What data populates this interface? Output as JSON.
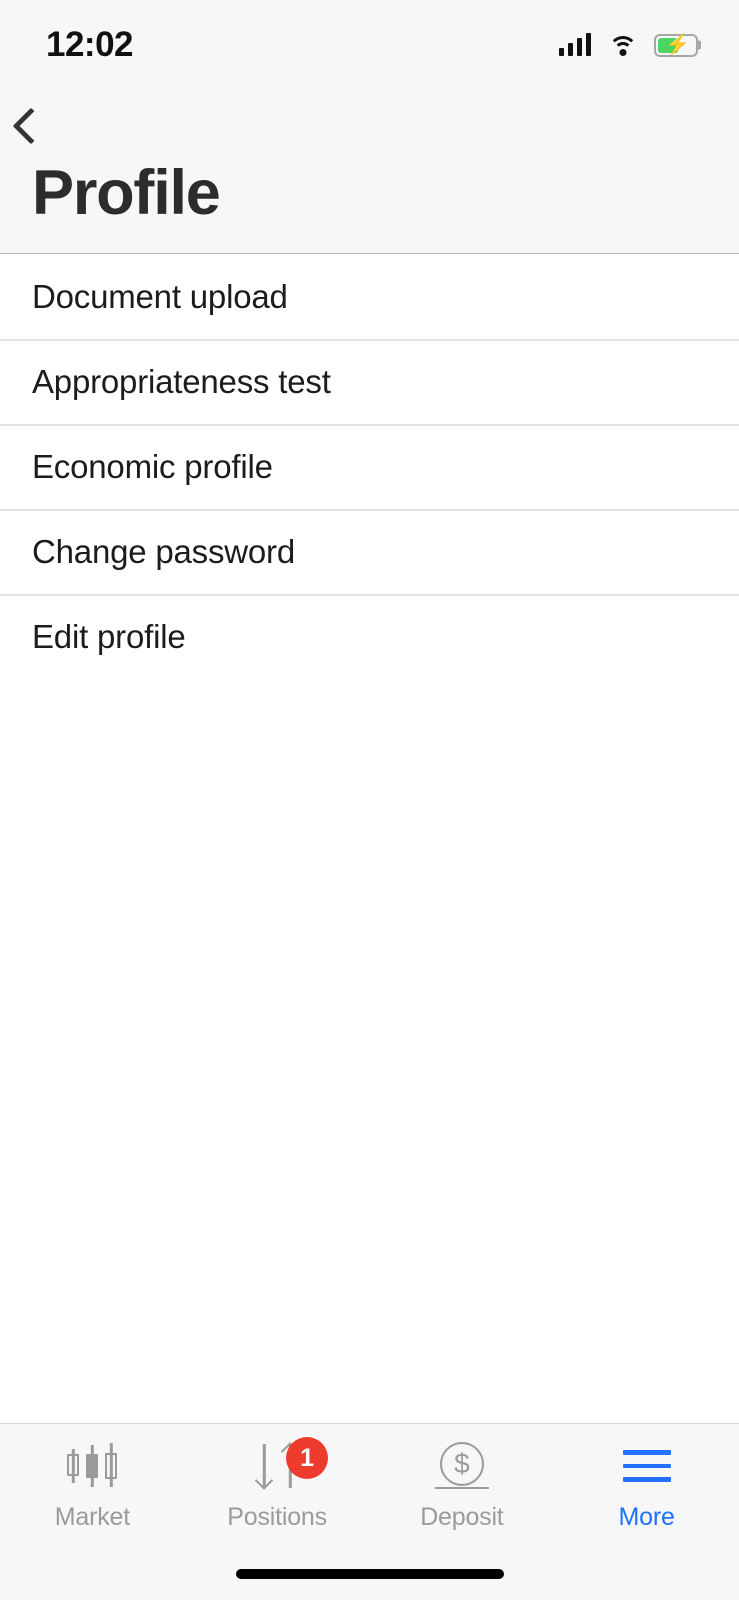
{
  "status_bar": {
    "time": "12:02",
    "signal_icon": "signal-bars-icon",
    "wifi_icon": "wifi-icon",
    "battery_icon": "battery-charging-icon",
    "battery_level_percent": 55,
    "battery_charging": true
  },
  "header": {
    "back_icon": "chevron-left-icon",
    "title": "Profile"
  },
  "list": {
    "items": [
      {
        "label": "Document upload"
      },
      {
        "label": "Appropriateness test"
      },
      {
        "label": "Economic profile"
      },
      {
        "label": "Change password"
      },
      {
        "label": "Edit profile"
      }
    ]
  },
  "tabbar": {
    "tabs": [
      {
        "label": "Market",
        "icon": "candlestick-chart-icon",
        "active": false,
        "badge": ""
      },
      {
        "label": "Positions",
        "icon": "arrows-down-up-icon",
        "active": false,
        "badge": "1"
      },
      {
        "label": "Deposit",
        "icon": "dollar-coin-icon",
        "active": false,
        "badge": ""
      },
      {
        "label": "More",
        "icon": "hamburger-menu-icon",
        "active": true,
        "badge": ""
      }
    ]
  },
  "colors": {
    "accent": "#2272ff",
    "badge": "#ed3b2e",
    "inactive_tab": "#9b9b9b",
    "header_bg": "#f7f7f7",
    "content_bg": "#ffffff",
    "text_primary": "#1c1c1c",
    "battery_fill": "#4cd562"
  },
  "home_indicator": "home-indicator-bar"
}
